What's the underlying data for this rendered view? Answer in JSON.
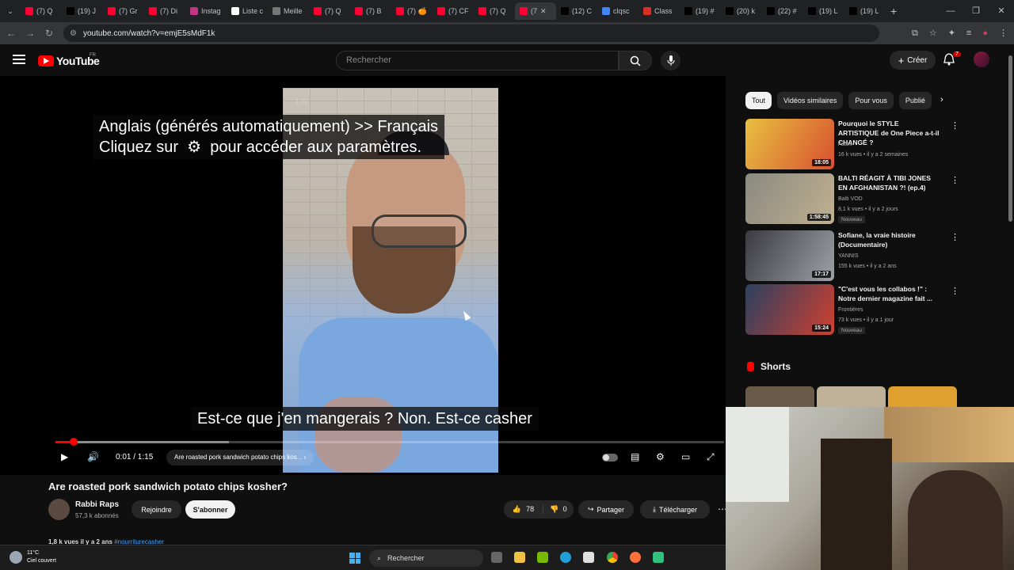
{
  "browser": {
    "tabs": [
      {
        "label": "(7) Q",
        "color": "#ff0033"
      },
      {
        "label": "(19) J",
        "color": "#000000"
      },
      {
        "label": "(7) Gr",
        "color": "#ff0033"
      },
      {
        "label": "(7) Di",
        "color": "#ff0033"
      },
      {
        "label": "Instag",
        "color": "#c13584"
      },
      {
        "label": "Liste c",
        "color": "#ffffff"
      },
      {
        "label": "Meille",
        "color": "#777777"
      },
      {
        "label": "(7) Q",
        "color": "#ff0033"
      },
      {
        "label": "(7) B",
        "color": "#ff0033"
      },
      {
        "label": "(7) 🍊",
        "color": "#ff0033"
      },
      {
        "label": "(7) CF",
        "color": "#ff0033"
      },
      {
        "label": "(7) Q",
        "color": "#ff0033"
      },
      {
        "label": "(7",
        "color": "#ff0033",
        "active": true
      },
      {
        "label": "(12) C",
        "color": "#000000"
      },
      {
        "label": "clqsc",
        "color": "#4285f4"
      },
      {
        "label": "Class",
        "color": "#d93025"
      },
      {
        "label": "(19) #",
        "color": "#000000"
      },
      {
        "label": "(20) k",
        "color": "#000000"
      },
      {
        "label": "(22) #",
        "color": "#000000"
      },
      {
        "label": "(19) L",
        "color": "#000000"
      },
      {
        "label": "(19) L",
        "color": "#000000"
      }
    ],
    "url": "youtube.com/watch?v=emjE5sMdF1k"
  },
  "header": {
    "logo_text": "YouTube",
    "country": "FR",
    "search_placeholder": "Rechercher",
    "create_label": "Créer",
    "notif_count": "7"
  },
  "player": {
    "overlay_time": "1:00",
    "caption_top": "Anglais (générés automatiquement) >> Français\nCliquez sur  ⚙  pour accéder aux paramètres.",
    "caption_bottom": "Est-ce que j'en mangerais ? Non. Est-ce casher",
    "time": "0:01 / 1:15",
    "chapter": "Are roasted pork sandwich potato chips kos...",
    "progress_fraction": 0.027,
    "buffer_fraction": 0.26
  },
  "video": {
    "title": "Are roasted pork sandwich potato chips kosher?",
    "channel": "Rabbi Raps",
    "subscribers": "57,3 k abonnés",
    "join_label": "Rejoindre",
    "subscribe_label": "S'abonner",
    "likes": "78",
    "dislikes": "0",
    "share_label": "Partager",
    "download_label": "Télécharger",
    "desc_views": "1,8 k vues  il y a 2 ans",
    "desc_tag": "#nourriturecasher"
  },
  "sidebar": {
    "chips": [
      "Tout",
      "Vidéos similaires",
      "Pour vous",
      "Publié"
    ],
    "recommendations": [
      {
        "title": "Pourquoi le STYLE ARTISTIQUE de One Piece a-t-il CHANGÉ ?",
        "channel": "Asani",
        "meta": "16 k vues • il y a 2 semaines",
        "duration": "18:05",
        "new": "",
        "thumb_colors": [
          "#e8c040",
          "#d85030"
        ]
      },
      {
        "title": "BALTI RÉAGIT À TIBI JONES EN AFGHANISTAN ?! (ep.4)",
        "channel": "Balti VOD",
        "meta": "8,1 k vues • il y a 2 jours",
        "duration": "1:58:45",
        "new": "Nouveau",
        "thumb_colors": [
          "#8a8a80",
          "#c0b090"
        ]
      },
      {
        "title": "Sofiane, la vraie histoire (Documentaire)",
        "channel": "YANNIS",
        "meta": "155 k vues • il y a 2 ans",
        "duration": "17:17",
        "new": "",
        "thumb_colors": [
          "#3a3a40",
          "#a0a0a8"
        ]
      },
      {
        "title": "\"C'est vous les collabos !\" : Notre dernier magazine fait ...",
        "channel": "Frontières",
        "meta": "73 k vues • il y a 1 jour",
        "duration": "15:24",
        "new": "Nouveau",
        "thumb_colors": [
          "#2a4060",
          "#d04030"
        ]
      }
    ],
    "shorts_title": "Shorts"
  },
  "taskbar": {
    "temp": "11°C",
    "weather": "Ciel couvert",
    "search_label": "Rechercher"
  }
}
